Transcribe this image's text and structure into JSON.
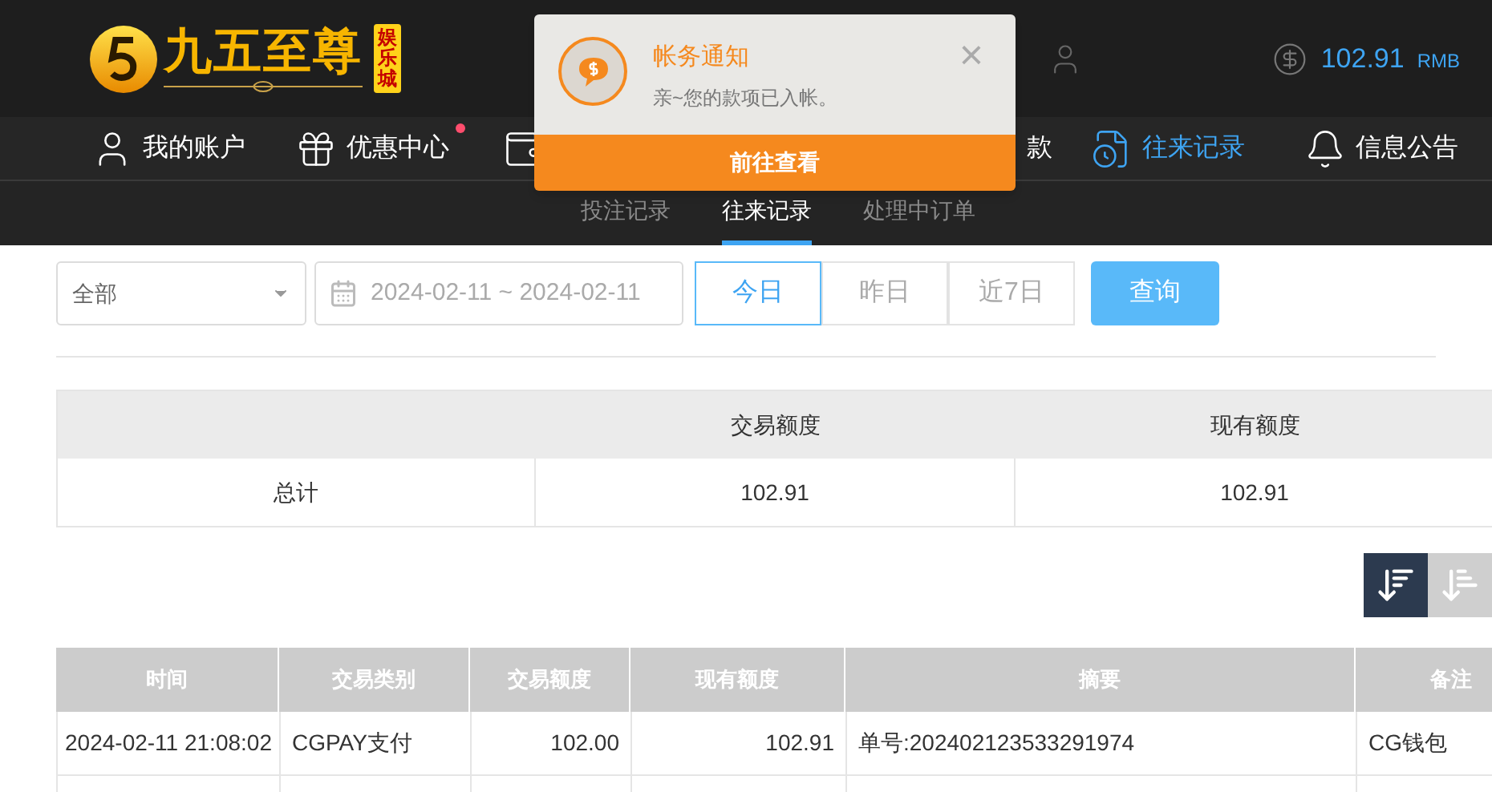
{
  "logo": {
    "name": "九五至尊",
    "badge": "娱乐城"
  },
  "balance": {
    "amount": "102.91",
    "currency": "RMB"
  },
  "nav": [
    {
      "label": "我的账户",
      "selected": false,
      "dot": false
    },
    {
      "label": "优惠中心",
      "selected": false,
      "dot": true
    },
    {
      "selected": false,
      "dot": false
    },
    {
      "label": "款",
      "selected": false,
      "dot": false
    },
    {
      "label": "往来记录",
      "selected": true,
      "dot": false
    },
    {
      "label": "信息公告",
      "selected": false,
      "dot": false
    }
  ],
  "subtabs": [
    {
      "label": "投注记录",
      "selected": false
    },
    {
      "label": "往来记录",
      "selected": true
    },
    {
      "label": "处理中订单",
      "selected": false
    }
  ],
  "filters": {
    "type": "全部",
    "date_range": "2024-02-11 ~ 2024-02-11",
    "ranges": [
      {
        "label": "今日",
        "selected": true
      },
      {
        "label": "昨日",
        "selected": false
      },
      {
        "label": "近7日",
        "selected": false
      }
    ],
    "query": "查询"
  },
  "summary": {
    "columns": [
      "交易额度",
      "现有额度"
    ],
    "row": {
      "label": "总计",
      "cells": [
        "102.91",
        "102.91"
      ]
    }
  },
  "sort_buttons": [
    {
      "selected": true
    },
    {
      "selected": false
    }
  ],
  "table": {
    "columns": [
      "时间",
      "交易类别",
      "交易额度",
      "现有额度",
      "摘要",
      "备注"
    ],
    "rows": [
      [
        "2024-02-11 21:08:02",
        "CGPAY支付",
        "102.00",
        "102.91",
        "单号:202402123533291974",
        "CG钱包"
      ]
    ]
  },
  "notification": {
    "title": "帐务通知",
    "message": "亲~您的款项已入帐。",
    "close": "×",
    "action": "前往查看"
  }
}
